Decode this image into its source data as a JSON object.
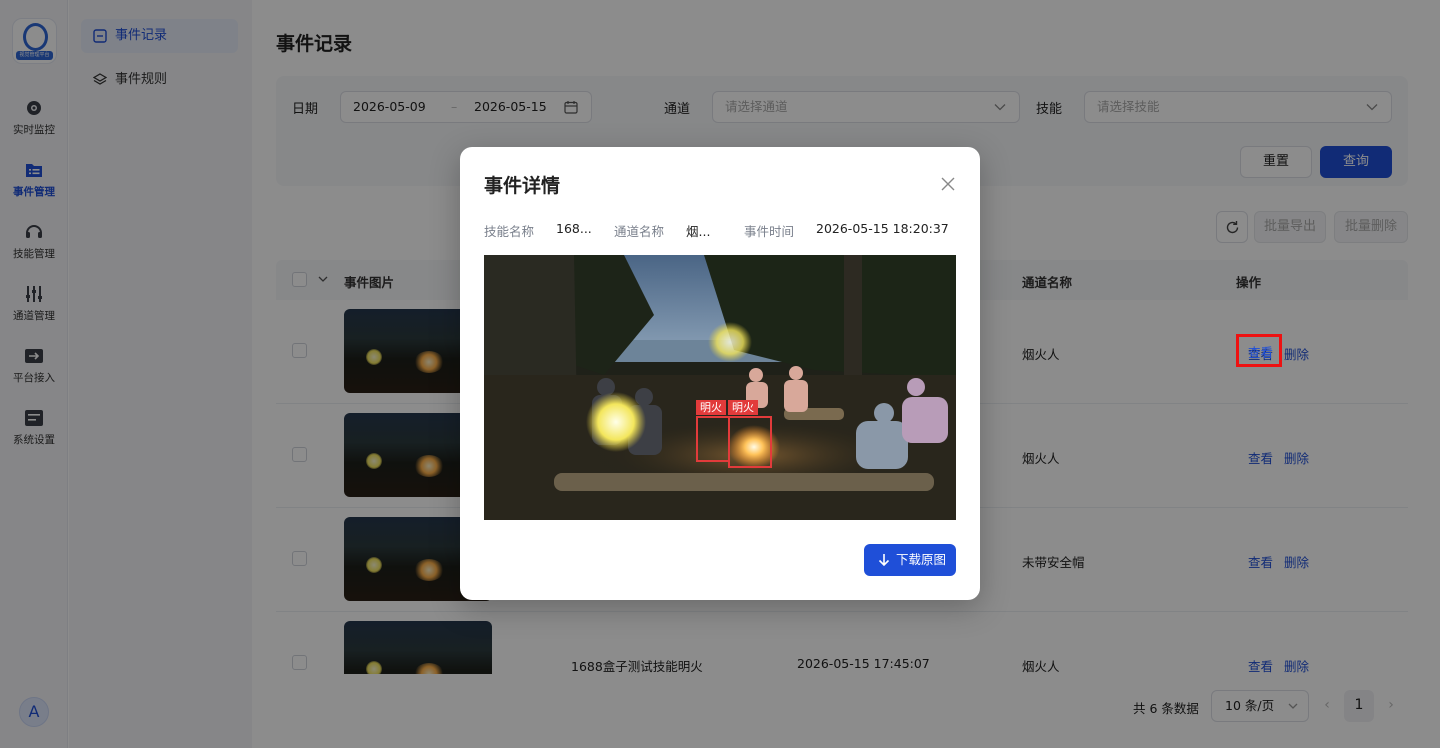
{
  "app": {
    "logo_text": "视觉管理平台",
    "user_avatar": "A"
  },
  "rail": {
    "items": [
      {
        "label": "实时监控",
        "icon": "camera-icon"
      },
      {
        "label": "事件管理",
        "icon": "event-list-icon",
        "active": true
      },
      {
        "label": "技能管理",
        "icon": "headset-icon"
      },
      {
        "label": "通道管理",
        "icon": "sliders-icon"
      },
      {
        "label": "平台接入",
        "icon": "login-box-icon"
      },
      {
        "label": "系统设置",
        "icon": "settings-panel-icon"
      }
    ]
  },
  "submenu": {
    "items": [
      {
        "label": "事件记录",
        "icon": "minus-square-icon",
        "active": true
      },
      {
        "label": "事件规则",
        "icon": "layers-icon"
      }
    ]
  },
  "page": {
    "title": "事件记录"
  },
  "filters": {
    "date_label": "日期",
    "date_start": "2026-05-09",
    "date_separator": "–",
    "date_end": "2026-05-15",
    "channel_label": "通道",
    "channel_placeholder": "请选择通道",
    "skill_label": "技能",
    "skill_placeholder": "请选择技能",
    "reset_label": "重置",
    "query_label": "查询"
  },
  "toolbar": {
    "export_label": "批量导出",
    "delete_label": "批量删除"
  },
  "table": {
    "headers": {
      "image": "事件图片",
      "channel": "通道名称",
      "actions": "操作"
    },
    "rows": [
      {
        "skill": "",
        "time": "",
        "channel": "烟火人",
        "view": "查看",
        "delete": "删除"
      },
      {
        "skill": "",
        "time": "",
        "channel": "烟火人",
        "view": "查看",
        "delete": "删除"
      },
      {
        "skill": "",
        "time": "",
        "channel": "未带安全帽",
        "view": "查看",
        "delete": "删除"
      },
      {
        "skill": "1688盒子测试技能明火",
        "time": "2026-05-15 17:45:07",
        "channel": "烟火人",
        "view": "查看",
        "delete": "删除"
      }
    ]
  },
  "pagination": {
    "total": "共 6 条数据",
    "page_size": "10 条/页",
    "current": "1"
  },
  "modal": {
    "title": "事件详情",
    "skill_key": "技能名称",
    "skill_value": "168...",
    "channel_key": "通道名称",
    "channel_value": "烟...",
    "time_key": "事件时间",
    "time_value": "2026-05-15 18:20:37",
    "detections": [
      {
        "label": "明火"
      },
      {
        "label": "明火"
      }
    ],
    "download_label": "下载原图"
  },
  "colors": {
    "primary": "#1f4fd8",
    "detection": "#e23b3b",
    "highlight": "#ee1111"
  }
}
